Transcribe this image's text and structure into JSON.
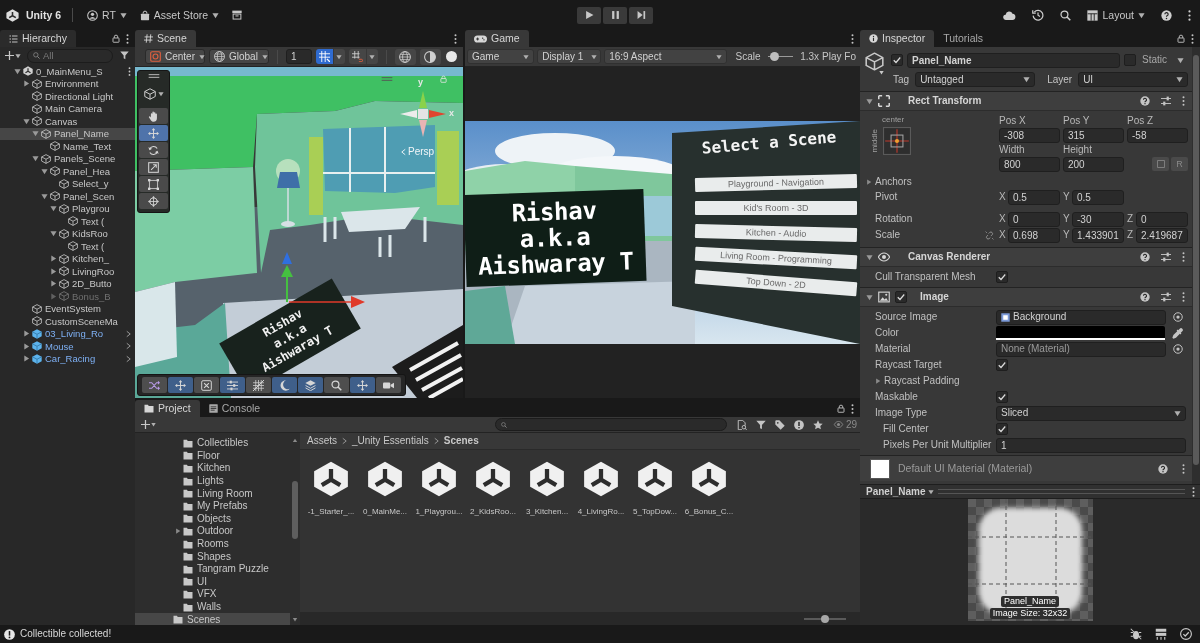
{
  "toolbar": {
    "product": "Unity 6",
    "account": "RT",
    "store": "Asset Store",
    "layout": "Layout"
  },
  "hierarchy": {
    "tab": "Hierarchy",
    "search": {
      "placeholder": "All"
    },
    "items": [
      {
        "name": "0_MainMenu_S",
        "kind": "scene",
        "expanded": true,
        "selected": false,
        "disabled": false,
        "children": [
          {
            "name": "Environment",
            "kind": "object",
            "expanded": false,
            "selected": false,
            "disabled": false
          },
          {
            "name": "Directional Light",
            "kind": "object",
            "selected": false,
            "disabled": false
          },
          {
            "name": "Main Camera",
            "kind": "object",
            "selected": false,
            "disabled": false
          },
          {
            "name": "Canvas",
            "kind": "object",
            "expanded": true,
            "selected": false,
            "disabled": false,
            "children": [
              {
                "name": "Panel_Name",
                "kind": "object",
                "expanded": true,
                "selected": true,
                "disabled": false,
                "children": [
                  {
                    "name": "Name_Text",
                    "kind": "object",
                    "selected": false,
                    "disabled": false
                  }
                ]
              },
              {
                "name": "Panels_Scene",
                "kind": "object",
                "expanded": true,
                "selected": false,
                "disabled": false,
                "children": [
                  {
                    "name": "Panel_Hea",
                    "kind": "object",
                    "expanded": true,
                    "selected": false,
                    "disabled": false,
                    "children": [
                      {
                        "name": "Select_y",
                        "kind": "object",
                        "selected": false,
                        "disabled": false
                      }
                    ]
                  },
                  {
                    "name": "Panel_Scen",
                    "kind": "object",
                    "expanded": true,
                    "selected": false,
                    "disabled": false,
                    "children": [
                      {
                        "name": "Playgrou",
                        "kind": "object",
                        "expanded": true,
                        "selected": false,
                        "disabled": false,
                        "children": [
                          {
                            "name": "Text (",
                            "kind": "object",
                            "selected": false,
                            "disabled": false
                          }
                        ]
                      },
                      {
                        "name": "KidsRoo",
                        "kind": "object",
                        "expanded": true,
                        "selected": false,
                        "disabled": false,
                        "children": [
                          {
                            "name": "Text (",
                            "kind": "object",
                            "selected": false,
                            "disabled": false
                          }
                        ]
                      },
                      {
                        "name": "Kitchen_",
                        "kind": "object",
                        "expanded": false,
                        "selected": false,
                        "disabled": false
                      },
                      {
                        "name": "LivingRoo",
                        "kind": "object",
                        "expanded": false,
                        "selected": false,
                        "disabled": false
                      },
                      {
                        "name": "2D_Butto",
                        "kind": "object",
                        "expanded": false,
                        "selected": false,
                        "disabled": false
                      },
                      {
                        "name": "Bonus_B",
                        "kind": "object",
                        "expanded": false,
                        "selected": false,
                        "disabled": true
                      }
                    ]
                  }
                ]
              }
            ]
          },
          {
            "name": "EventSystem",
            "kind": "object",
            "selected": false,
            "disabled": false
          },
          {
            "name": "CustomSceneMa",
            "kind": "object",
            "selected": false,
            "disabled": false
          },
          {
            "name": "03_Living_Ro",
            "kind": "prefab",
            "expanded": false,
            "selected": false,
            "disabled": false
          },
          {
            "name": "Mouse",
            "kind": "prefab",
            "expanded": false,
            "selected": false,
            "disabled": false
          },
          {
            "name": "Car_Racing",
            "kind": "prefab",
            "expanded": false,
            "selected": false,
            "disabled": false
          }
        ]
      }
    ]
  },
  "scene_view": {
    "tab": "Scene",
    "pivot_mode": "Center",
    "pivot_rotation": "Global",
    "grid_size": "1",
    "grid_snap": true,
    "increment_snap": false,
    "tools": [
      {
        "selected": false
      },
      {
        "selected": true
      },
      {
        "selected": false
      },
      {
        "selected": false
      },
      {
        "selected": false
      },
      {
        "selected": false
      }
    ],
    "axis_labels": [
      "y",
      "x"
    ],
    "projection": "Persp",
    "name_panel": [
      "Rishav",
      "a.k.a",
      "Aishwaray T"
    ],
    "overlay_buttons": [
      {
        "on": false
      },
      {
        "on": true
      },
      {
        "on": false
      },
      {
        "on": true
      },
      {
        "on": false
      },
      {
        "on": true
      },
      {
        "on": true
      },
      {
        "on": false
      },
      {
        "on": true
      },
      {
        "on": false
      }
    ]
  },
  "game_view": {
    "tab": "Game",
    "mode": "Game",
    "display": "Display 1",
    "aspect": "16:9 Aspect",
    "scale_label": "Scale",
    "scale": {
      "level": 0.12
    },
    "scale_reading": "1.3x",
    "play_focus": "Play Fo",
    "name_panel": [
      "Rishav",
      "a.k.a",
      "Aishwaray T"
    ],
    "menu": {
      "title": "Select a Scene",
      "buttons": [
        "Playground - Navigation",
        "Kid's Room - 3D",
        "Kitchen - Audio",
        "Living Room - Programming",
        "Top Down - 2D"
      ]
    }
  },
  "project": {
    "tabs": [
      {
        "label": "Project",
        "selected": true
      },
      {
        "label": "Console",
        "selected": false
      }
    ],
    "count": "29",
    "folders": [
      {
        "children": [
          {
            "name": "Collectibles",
            "selected": false
          },
          {
            "name": "Floor",
            "selected": false
          },
          {
            "name": "Kitchen",
            "selected": false
          },
          {
            "name": "Lights",
            "selected": false
          },
          {
            "name": "Living Room",
            "selected": false
          },
          {
            "name": "My Prefabs",
            "selected": false
          },
          {
            "name": "Objects",
            "selected": false
          },
          {
            "name": "Outdoor",
            "expanded": false,
            "selected": false
          },
          {
            "name": "Rooms",
            "selected": false
          },
          {
            "name": "Shapes",
            "selected": false
          },
          {
            "name": "Tangram Puzzle",
            "selected": false
          },
          {
            "name": "UI",
            "selected": false
          },
          {
            "name": "VFX",
            "selected": false
          },
          {
            "name": "Walls",
            "selected": false
          }
        ]
      },
      {
        "name": "Scenes",
        "selected": true
      }
    ],
    "breadcrumb": [
      "Assets",
      "_Unity Essentials",
      "Scenes"
    ],
    "assets": [
      {
        "name": "-1_Starter_...",
        "selected": false
      },
      {
        "name": "0_MainMe...",
        "selected": false
      },
      {
        "name": "1_Playgrou...",
        "selected": false
      },
      {
        "name": "2_KidsRoo...",
        "selected": false
      },
      {
        "name": "3_Kitchen...",
        "selected": false
      },
      {
        "name": "4_LivingRo...",
        "selected": false
      },
      {
        "name": "5_TopDow...",
        "selected": false
      },
      {
        "name": "6_Bonus_C...",
        "selected": false
      }
    ],
    "icon_size": {
      "level": 0.5
    }
  },
  "inspector": {
    "tabs": [
      {
        "label": "Inspector",
        "selected": true
      },
      {
        "label": "Tutorials",
        "selected": false
      }
    ],
    "object": {
      "active": true,
      "name": "Panel_Name",
      "static": false,
      "static_label": "Static",
      "tag_label": "Tag",
      "tag": "Untagged",
      "layer_label": "Layer",
      "layer": "UI"
    },
    "rect_transform": {
      "title": "Rect Transform",
      "expanded": true,
      "anchor_horizontal": "center",
      "anchor_vertical": "middle",
      "position": [
        {
          "label": "Pos X",
          "value": "-308"
        },
        {
          "label": "Pos Y",
          "value": "315"
        },
        {
          "label": "Pos Z",
          "value": "-58"
        }
      ],
      "size": [
        {
          "label": "Width",
          "value": "800"
        },
        {
          "label": "Height",
          "value": "200"
        }
      ],
      "raw_edit": "R",
      "anchors": {
        "label": "Anchors",
        "expanded": false
      },
      "vectors": [
        {
          "label": "Pivot",
          "fields": [
            {
              "axis": "X",
              "value": "0.5"
            },
            {
              "axis": "Y",
              "value": "0.5"
            }
          ]
        },
        {
          "label": "Rotation",
          "fields": [
            {
              "axis": "X",
              "value": "0"
            },
            {
              "axis": "Y",
              "value": "-30"
            },
            {
              "axis": "Z",
              "value": "0"
            }
          ]
        },
        {
          "label": "Scale",
          "proportional": false,
          "fields": [
            {
              "axis": "X",
              "value": "0.698"
            },
            {
              "axis": "Y",
              "value": "1.433901"
            },
            {
              "axis": "Z",
              "value": "2.419687"
            }
          ]
        }
      ]
    },
    "components": [
      {
        "kind": "canvas_renderer",
        "title": "Canvas Renderer",
        "expanded": true,
        "properties": [
          {
            "kind": "checkbox",
            "label": "Cull Transparent Mesh",
            "checked": true
          }
        ]
      },
      {
        "kind": "image",
        "title": "Image",
        "enabled": true,
        "expanded": true,
        "properties": [
          {
            "kind": "object",
            "label": "Source Image",
            "value": "Background",
            "assigned": true
          },
          {
            "kind": "color",
            "label": "Color",
            "color": "#000000",
            "level": 1
          },
          {
            "kind": "object",
            "label": "Material",
            "value": "None (Material)",
            "assigned": false
          },
          {
            "kind": "checkbox",
            "label": "Raycast Target",
            "checked": true
          },
          {
            "kind": "foldout",
            "label": "Raycast Padding",
            "expanded": false
          },
          {
            "kind": "checkbox",
            "label": "Maskable",
            "checked": true
          },
          {
            "kind": "dropdown",
            "label": "Image Type",
            "value": "Sliced",
            "children": [
              {
                "kind": "checkbox",
                "label": "Fill Center",
                "checked": true
              },
              {
                "kind": "number",
                "label": "Pixels Per Unit Multiplier",
                "value": "1"
              }
            ]
          }
        ]
      }
    ],
    "material": {
      "title": "Default UI Material (Material)"
    },
    "preview": {
      "title": "Panel_Name",
      "caption": "Panel_Name",
      "size": "Image Size: 32x32"
    }
  },
  "status_bar": {
    "message": "Collectible collected!"
  }
}
